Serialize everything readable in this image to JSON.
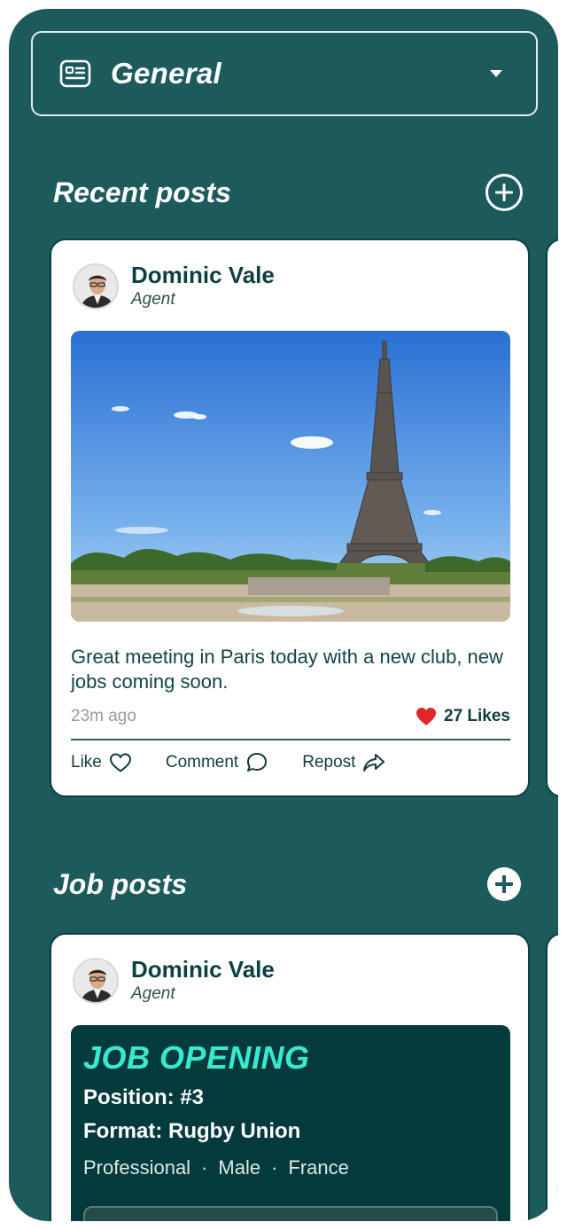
{
  "selector": {
    "label": "General",
    "icon": "id-card-icon",
    "caret": "caret-down-icon"
  },
  "recent": {
    "title": "Recent posts",
    "add_icon": "plus-circle-icon",
    "post": {
      "author": "Dominic Vale",
      "role": "Agent",
      "text": "Great meeting in Paris today with a new club, new jobs coming soon.",
      "time": "23m ago",
      "likes": "27 Likes",
      "actions": {
        "like": "Like",
        "comment": "Comment",
        "repost": "Repost"
      }
    }
  },
  "jobs": {
    "title": "Job posts",
    "add_icon": "plus-filled-icon",
    "post": {
      "author": "Dominic Vale",
      "role": "Agent",
      "heading": "JOB OPENING",
      "position": "Position: #3",
      "format": "Format: Rugby Union",
      "tags": [
        "Professional",
        "Male",
        "France"
      ],
      "separator": "·"
    }
  },
  "colors": {
    "background": "#1d5a5b",
    "accent": "#38e8cf",
    "heart": "#e0262a",
    "dark_teal": "#033a3b"
  }
}
